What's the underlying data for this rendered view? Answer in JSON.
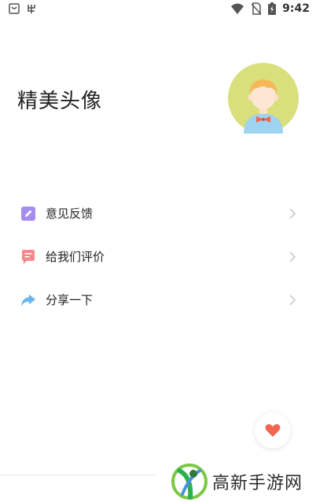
{
  "status_bar": {
    "time": "9:42",
    "left_icons": [
      "notification-icon",
      "app-icon"
    ],
    "right_icons": [
      "wifi-icon",
      "no-sim-icon",
      "battery-charging-icon"
    ]
  },
  "header": {
    "title": "精美头像",
    "avatar_icon": "cartoon-boy-avatar"
  },
  "menu": {
    "items": [
      {
        "label": "意见反馈",
        "icon": "edit-icon",
        "color": "#a58cf0"
      },
      {
        "label": "给我们评价",
        "icon": "comment-icon",
        "color": "#f58a8a"
      },
      {
        "label": "分享一下",
        "icon": "share-icon",
        "color": "#66b6f2"
      }
    ]
  },
  "fab": {
    "icon": "heart-icon",
    "color": "#f2664f"
  },
  "watermark": {
    "text": "高新手游网"
  },
  "colors": {
    "avatar_bg": "#d9df7a",
    "chevron": "#c4c4c4"
  }
}
